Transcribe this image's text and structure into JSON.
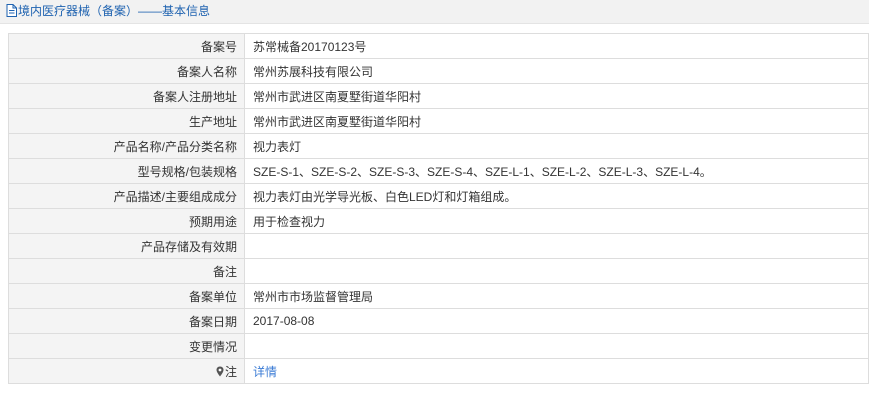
{
  "header": {
    "icon": "document-icon",
    "title": "境内医疗器械（备案）——基本信息"
  },
  "rows": [
    {
      "label": "备案号",
      "value": "苏常械备20170123号"
    },
    {
      "label": "备案人名称",
      "value": "常州苏展科技有限公司"
    },
    {
      "label": "备案人注册地址",
      "value": "常州市武进区南夏墅街道华阳村"
    },
    {
      "label": "生产地址",
      "value": "常州市武进区南夏墅街道华阳村"
    },
    {
      "label": "产品名称/产品分类名称",
      "value": "视力表灯"
    },
    {
      "label": "型号规格/包装规格",
      "value": "SZE-S-1、SZE-S-2、SZE-S-3、SZE-S-4、SZE-L-1、SZE-L-2、SZE-L-3、SZE-L-4。"
    },
    {
      "label": "产品描述/主要组成成分",
      "value": "视力表灯由光学导光板、白色LED灯和灯箱组成。"
    },
    {
      "label": "预期用途",
      "value": "用于检查视力"
    },
    {
      "label": "产品存储及有效期",
      "value": ""
    },
    {
      "label": "备注",
      "value": ""
    },
    {
      "label": "备案单位",
      "value": "常州市市场监督管理局"
    },
    {
      "label": "备案日期",
      "value": "2017-08-08"
    },
    {
      "label": "变更情况",
      "value": ""
    }
  ],
  "note_row": {
    "icon": "info-pin-icon",
    "label": "注",
    "link_text": "详情"
  },
  "colors": {
    "header_text": "#1e62b0",
    "link": "#3a7bd5",
    "label_bg": "#f4f4f4",
    "border": "#dddddd"
  }
}
